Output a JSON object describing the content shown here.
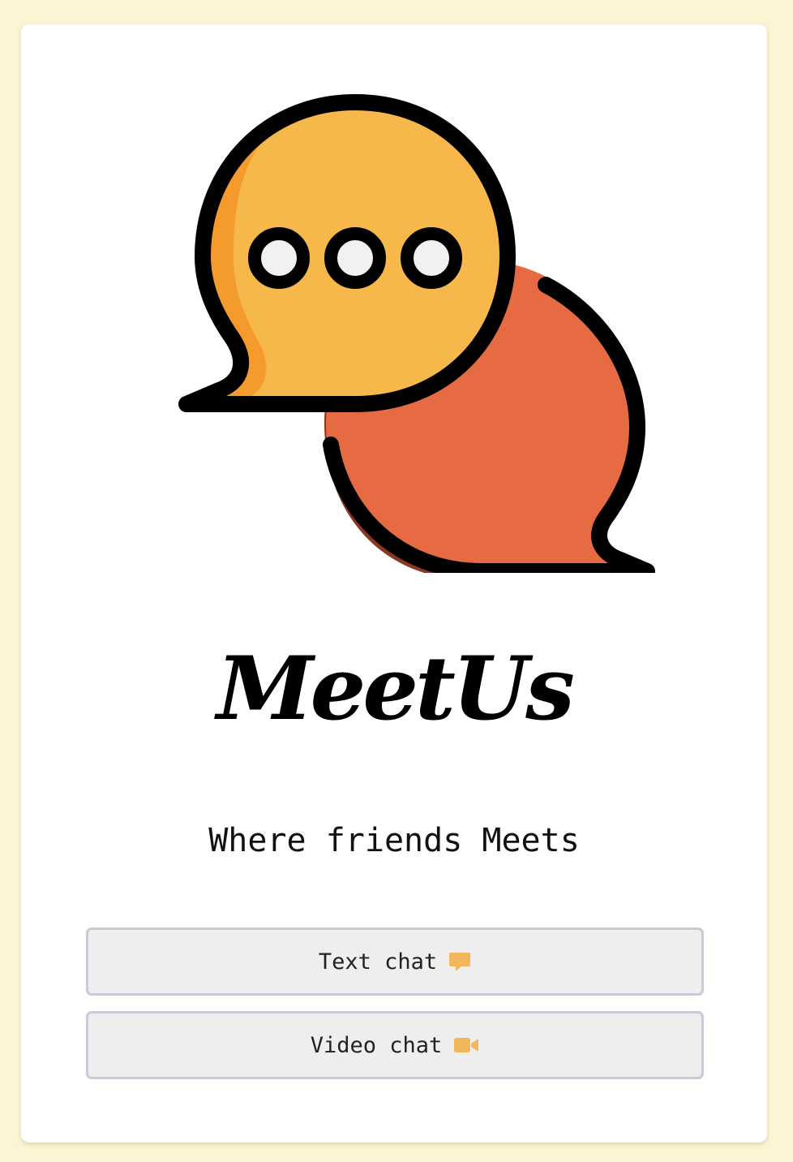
{
  "app": {
    "name": "MeetUs",
    "tagline": "Where friends Meets"
  },
  "buttons": {
    "text_chat": {
      "label": "Text chat",
      "icon": "comment-icon"
    },
    "video_chat": {
      "label": "Video chat",
      "icon": "video-camera-icon"
    }
  },
  "colors": {
    "background": "#fcf5d4",
    "card": "#ffffff",
    "bubble_yellow": "#f7b84b",
    "bubble_orange": "#e66b42",
    "icon_accent": "#f0b85a",
    "button_bg": "#eeeeef",
    "button_border": "#c6cad9"
  }
}
